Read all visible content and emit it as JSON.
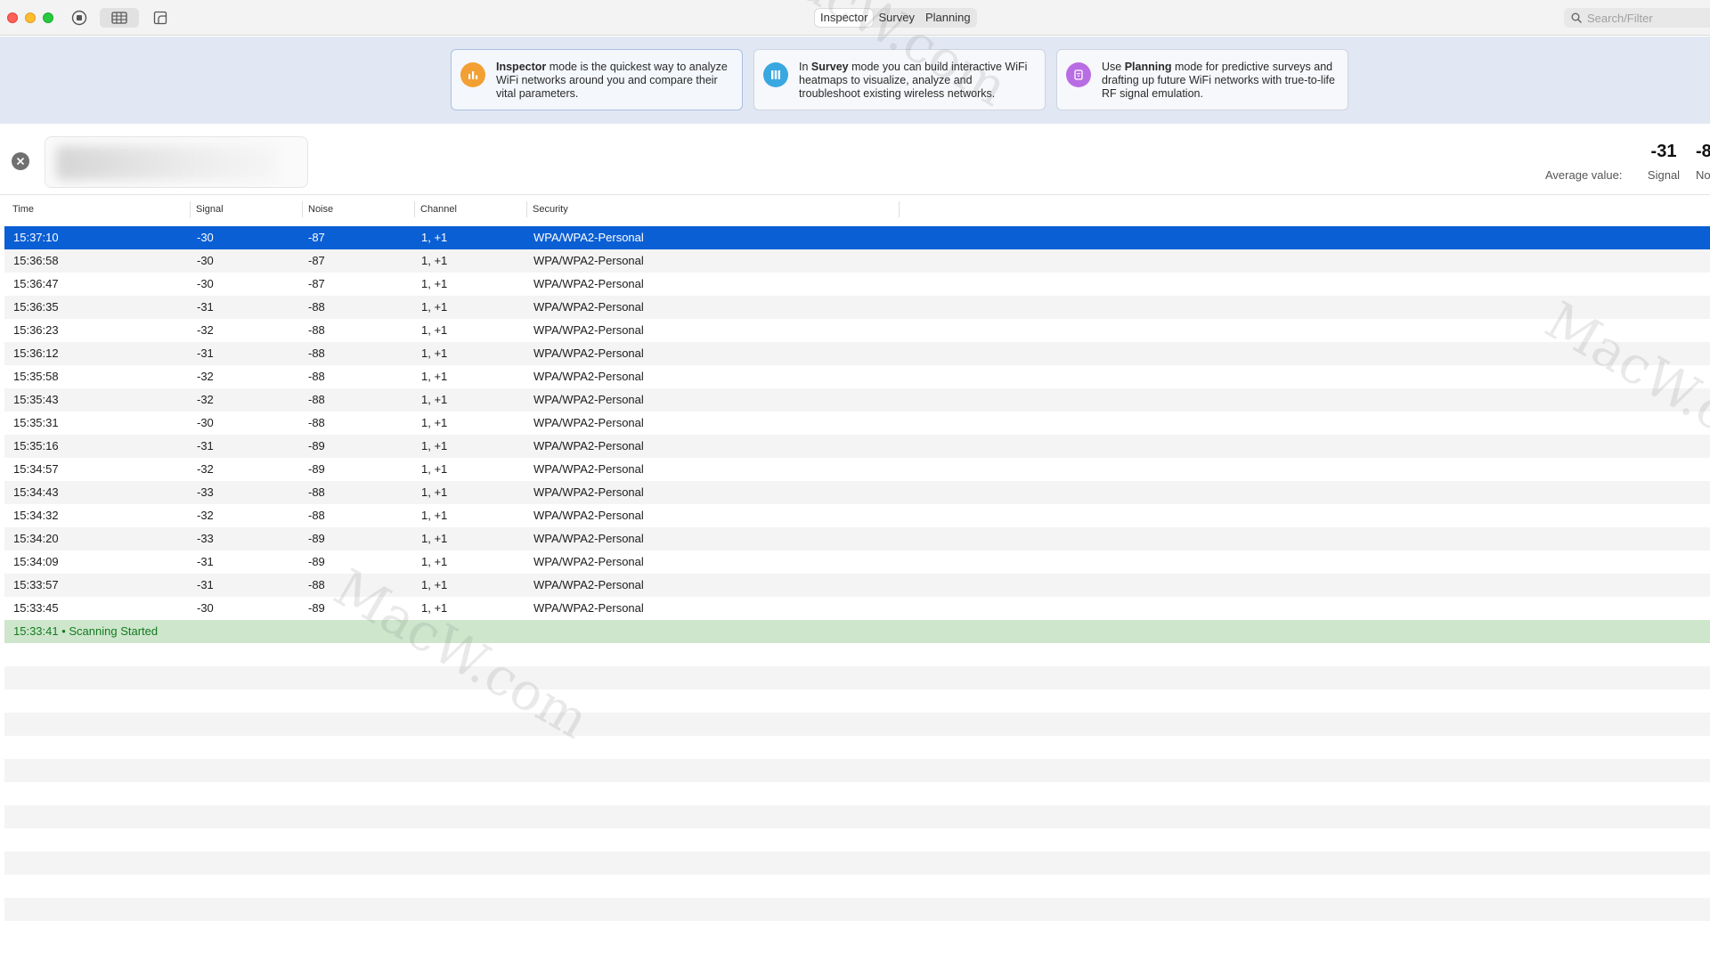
{
  "toolbar": {
    "modes": [
      "Inspector",
      "Survey",
      "Planning"
    ],
    "active_mode": "Inspector",
    "search_placeholder": "Search/Filter"
  },
  "banner": {
    "cards": [
      {
        "bold": "Inspector",
        "pre": "",
        "text": " mode is the quickest way to analyze WiFi networks around you and compare their vital parameters.",
        "icon": "chart-bars-icon",
        "color": "#f2a033"
      },
      {
        "bold": "Survey",
        "pre": "In ",
        "text": " mode you can build interactive WiFi heatmaps to visualize, analyze and troubleshoot existing wireless networks.",
        "icon": "survey-columns-icon",
        "color": "#3aa8e0"
      },
      {
        "bold": "Planning",
        "pre": "Use ",
        "text": " mode for predictive surveys and drafting up future WiFi networks with true-to-life RF signal emulation.",
        "icon": "wifi-router-icon",
        "color": "#b86de3"
      }
    ]
  },
  "network": {
    "average_label": "Average value:",
    "signal_value": "-31",
    "signal_label": "Signal",
    "noise_value": "-8",
    "noise_label": "No"
  },
  "table": {
    "columns": [
      "Time",
      "Signal",
      "Noise",
      "Channel",
      "Security"
    ],
    "rows": [
      [
        "15:37:10",
        "-30",
        "-87",
        "1, +1",
        "WPA/WPA2-Personal"
      ],
      [
        "15:36:58",
        "-30",
        "-87",
        "1, +1",
        "WPA/WPA2-Personal"
      ],
      [
        "15:36:47",
        "-30",
        "-87",
        "1, +1",
        "WPA/WPA2-Personal"
      ],
      [
        "15:36:35",
        "-31",
        "-88",
        "1, +1",
        "WPA/WPA2-Personal"
      ],
      [
        "15:36:23",
        "-32",
        "-88",
        "1, +1",
        "WPA/WPA2-Personal"
      ],
      [
        "15:36:12",
        "-31",
        "-88",
        "1, +1",
        "WPA/WPA2-Personal"
      ],
      [
        "15:35:58",
        "-32",
        "-88",
        "1, +1",
        "WPA/WPA2-Personal"
      ],
      [
        "15:35:43",
        "-32",
        "-88",
        "1, +1",
        "WPA/WPA2-Personal"
      ],
      [
        "15:35:31",
        "-30",
        "-88",
        "1, +1",
        "WPA/WPA2-Personal"
      ],
      [
        "15:35:16",
        "-31",
        "-89",
        "1, +1",
        "WPA/WPA2-Personal"
      ],
      [
        "15:34:57",
        "-32",
        "-89",
        "1, +1",
        "WPA/WPA2-Personal"
      ],
      [
        "15:34:43",
        "-33",
        "-88",
        "1, +1",
        "WPA/WPA2-Personal"
      ],
      [
        "15:34:32",
        "-32",
        "-88",
        "1, +1",
        "WPA/WPA2-Personal"
      ],
      [
        "15:34:20",
        "-33",
        "-89",
        "1, +1",
        "WPA/WPA2-Personal"
      ],
      [
        "15:34:09",
        "-31",
        "-89",
        "1, +1",
        "WPA/WPA2-Personal"
      ],
      [
        "15:33:57",
        "-31",
        "-88",
        "1, +1",
        "WPA/WPA2-Personal"
      ],
      [
        "15:33:45",
        "-30",
        "-89",
        "1, +1",
        "WPA/WPA2-Personal"
      ]
    ],
    "selected_index": 0,
    "event_row": "15:33:41 • Scanning Started"
  },
  "watermark": "MacW.com",
  "colors": {
    "selection": "#0b5fd4",
    "event_bg": "#cde6cc",
    "event_text": "#157a1e",
    "banner_bg": "#e2e8f3"
  }
}
